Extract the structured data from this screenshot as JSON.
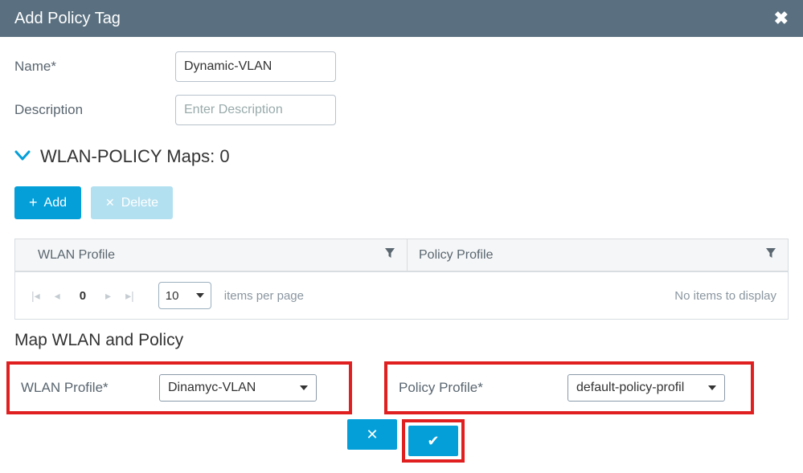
{
  "modal": {
    "title": "Add Policy Tag"
  },
  "form": {
    "name_label": "Name*",
    "name_value": "Dynamic-VLAN",
    "desc_label": "Description",
    "desc_placeholder": "Enter Description"
  },
  "section": {
    "title_prefix": "WLAN-POLICY Maps: ",
    "count": "0"
  },
  "buttons": {
    "add": "Add",
    "delete": "Delete"
  },
  "table": {
    "col1": "WLAN Profile",
    "col2": "Policy Profile"
  },
  "pager": {
    "page": "0",
    "page_size": "10",
    "ipp_label": "items per page",
    "empty": "No items to display"
  },
  "map": {
    "title": "Map WLAN and Policy",
    "wlan_label": "WLAN Profile*",
    "wlan_value": "Dinamyc-VLAN",
    "policy_label": "Policy Profile*",
    "policy_value": "default-policy-profil"
  }
}
